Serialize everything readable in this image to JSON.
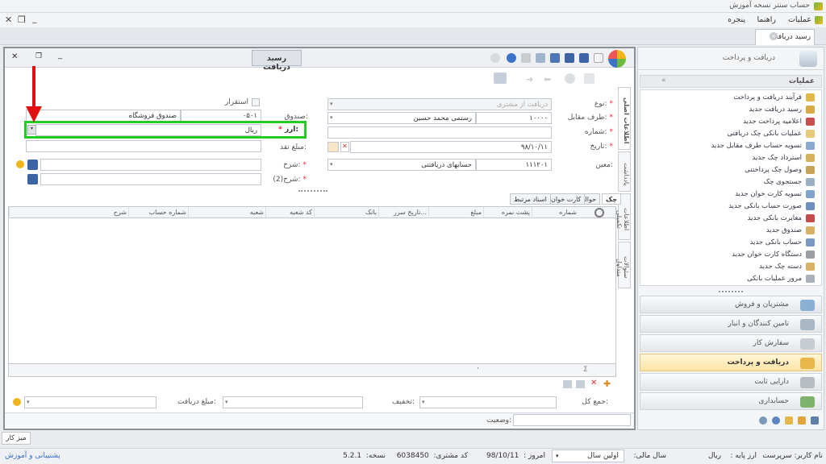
{
  "app": {
    "title": "حساب سنتر نسخه آموزش"
  },
  "menu": {
    "items": [
      "عملیات",
      "راهنما",
      "پنجره"
    ]
  },
  "doc_tab": {
    "label": "رسید دریافت"
  },
  "form": {
    "window_title": "رسید دریافت",
    "fields": {
      "type_label": "نوع:",
      "type_value": "دریافت از مشتری",
      "counterparty_label": "طرف مقابل:",
      "counterparty_code": "۱۰۰۰۰",
      "counterparty_name": "رستمی محمد حسین",
      "number_label": "شماره:",
      "date_label": "تاریخ:",
      "date_value": "۹۸/۱۰/۱۱",
      "moein_label": "معین:",
      "moein_code": "۱۱۱۲۰۱",
      "moein_name": "حسابهای دریافتنی",
      "esteghrar_label": "استقرار",
      "cashbox_label": "صندوق:",
      "cashbox_code": "۰۵۰۱",
      "cashbox_name": "صندوق فروشگاه",
      "currency_label": "ارز:",
      "currency_value": "ریال",
      "cash_amount_label": "مبلغ نقد:",
      "description_label": "شرح:",
      "description2_label": "شرح(2):"
    },
    "side_tabs": [
      "اطلاعات اصلی",
      "یادداشت",
      "اطلاعات تکمیلی",
      "سئوالات متداول"
    ],
    "grid_tabs": [
      "چک",
      "حواله",
      "کارت خوان",
      "اسناد مرتبط"
    ],
    "grid_columns": [
      "شماره",
      "پشت نمره",
      "مبلغ",
      "تاریخ سرر...",
      "بانک",
      "کد شعبه",
      "شعبه",
      "شماره حساب",
      "شرح"
    ],
    "footer": {
      "total_label": "جمع کل:",
      "discount_label": "تخفیف:",
      "received_label": "مبلغ دریافت:",
      "status_label": "وضعیت:"
    }
  },
  "right_panel": {
    "header": "دریافت و پرداخت",
    "ops_header": "عملیات",
    "ops": [
      "فرآیند دریافت و پرداخت",
      "رسید دریافت جدید",
      "اعلامیه پرداخت جدید",
      "عملیات بانکی چک دریافتی",
      "تسویه حساب طرف مقابل جدید",
      "استرداد چک جدید",
      "وصول چک پرداختنی",
      "جستجوی چک",
      "تسویه کارت خوان جدید",
      "صورت حساب بانکی جدید",
      "مغایرت بانکی جدید",
      "صندوق جدید",
      "حساب بانکی جدید",
      "دستگاه کارت خوان جدید",
      "دسته چک جدید",
      "مرور عملیات بانکی"
    ],
    "nav_groups": [
      "مشتریان و فروش",
      "تامین کنندگان و انبار",
      "سفارش کار",
      "دریافت و پرداخت",
      "دارایی ثابت",
      "حسابداری"
    ],
    "active_group_index": 3
  },
  "desktop_tab": "میز کار",
  "status": {
    "user_label": "نام کاربر:",
    "user_value": "سرپرست",
    "currency_label": "ارز پایه :",
    "currency_value": "ریال",
    "fiscal_label": "سال مالی:",
    "fiscal_value": "اولین سال",
    "today_label": "امروز :",
    "today_value": "98/10/11",
    "customer_code_label": "کد مشتری:",
    "customer_code_value": "6038450",
    "version_label": "نسخه:",
    "version_value": "5.2.1",
    "support_link": "پشتیبانی و آموزش"
  },
  "colors": {
    "accent_green": "#22cc22",
    "arrow_red": "#e01010",
    "active_nav": "#fde4a4"
  }
}
